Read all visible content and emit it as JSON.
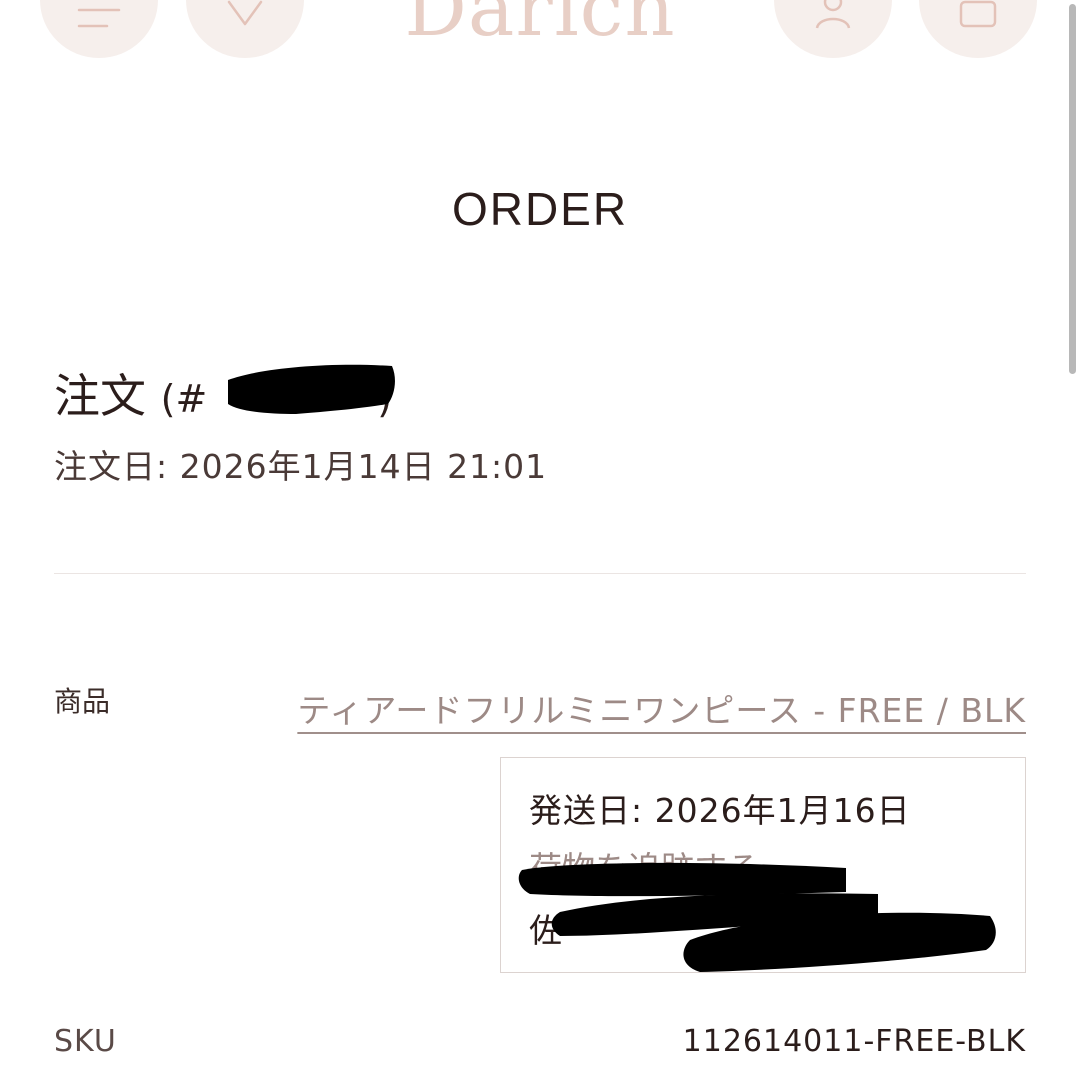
{
  "header": {
    "brand": "Darich",
    "icons": [
      "menu-icon",
      "heart-icon",
      "user-icon",
      "cart-icon"
    ]
  },
  "page": {
    "title": "ORDER"
  },
  "order": {
    "label": "注文",
    "number_visible": "(#",
    "number_close": ")",
    "date": "注文日: 2026年1月14日 21:01"
  },
  "item": {
    "product_label": "商品",
    "product_name": "ティアードフリルミニワンピース - FREE / BLK",
    "shipping": {
      "ship_date": "発送日: 2026年1月16日",
      "track_link": "荷物を追跡する",
      "carrier_prefix": "佐"
    },
    "sku_label": "SKU",
    "sku_value": "112614011-FREE-BLK"
  },
  "colors": {
    "accent": "#e8cfc6",
    "text": "#2b1d1b",
    "link": "#9d8a86",
    "icon_bg": "#f6efec"
  }
}
